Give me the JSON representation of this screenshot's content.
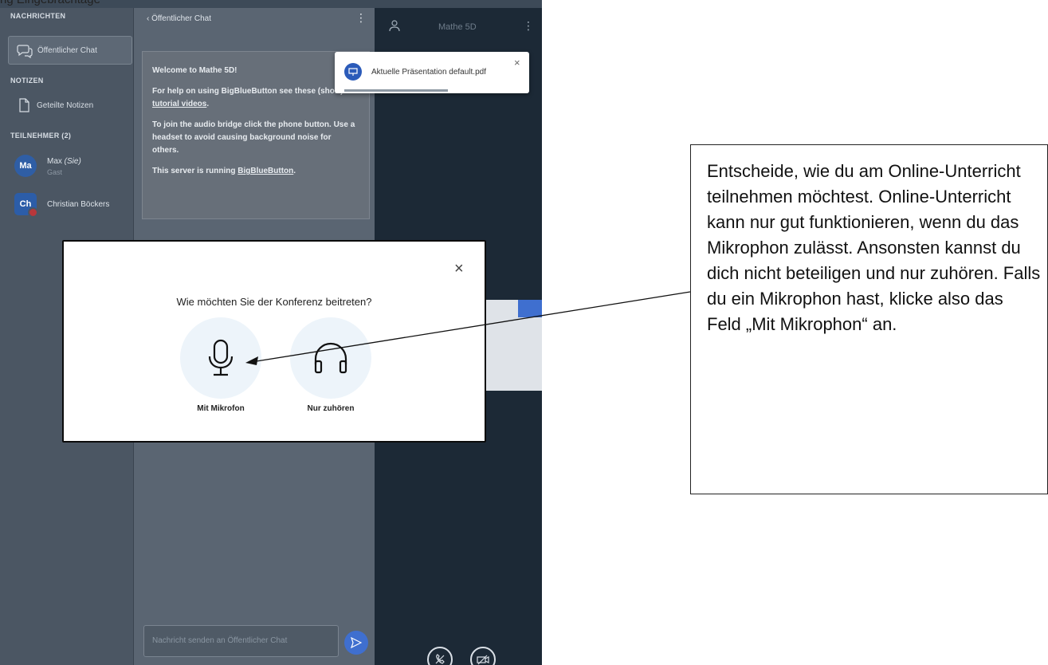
{
  "top_caption": "ng Eingebrachtage",
  "sidebar": {
    "messages_label": "NACHRICHTEN",
    "public_chat": "Öffentlicher Chat",
    "notes_label": "NOTIZEN",
    "shared_notes": "Geteilte Notizen",
    "participants_label": "TEILNEHMER (2)",
    "users": [
      {
        "initials": "Ma",
        "name": "Max (Sie)",
        "role": "Gast",
        "color": "#2f5ea5"
      },
      {
        "initials": "Ch",
        "name": "Christian Böckers",
        "role": "",
        "color": "#2c5da8"
      }
    ]
  },
  "chat": {
    "header": "Öffentlicher Chat",
    "welcome_title": "Welcome to Mathe 5D!",
    "help_text": "For help on using BigBlueButton see these (short)",
    "help_link": "tutorial videos",
    "audio_text": "To join the audio bridge click the phone button. Use a headset to avoid causing background noise for others.",
    "server_text": "This server is running",
    "server_link": "BigBlueButton",
    "input_placeholder": "Nachricht senden an Öffentlicher Chat"
  },
  "presentation": {
    "title": "Mathe 5D",
    "toast": "Aktuelle Präsentation default.pdf"
  },
  "modal": {
    "title": "Wie möchten Sie der Konferenz beitreten?",
    "mic_label": "Mit Mikrofon",
    "listen_label": "Nur zuhören",
    "close": "×"
  },
  "annotation": "Entscheide, wie du am Online-Unterricht teilnehmen möchtest. Online-Unterricht kann nur gut funktionieren, wenn du das Mikrophon zulässt. Ansonsten kannst du dich nicht beteiligen und nur zuhören. Falls du ein Mikrophon hast, klicke also das Feld „Mit Mikrophon“ an.",
  "colors": {
    "accent": "#3f6fcf",
    "muted": "#b8373b"
  }
}
